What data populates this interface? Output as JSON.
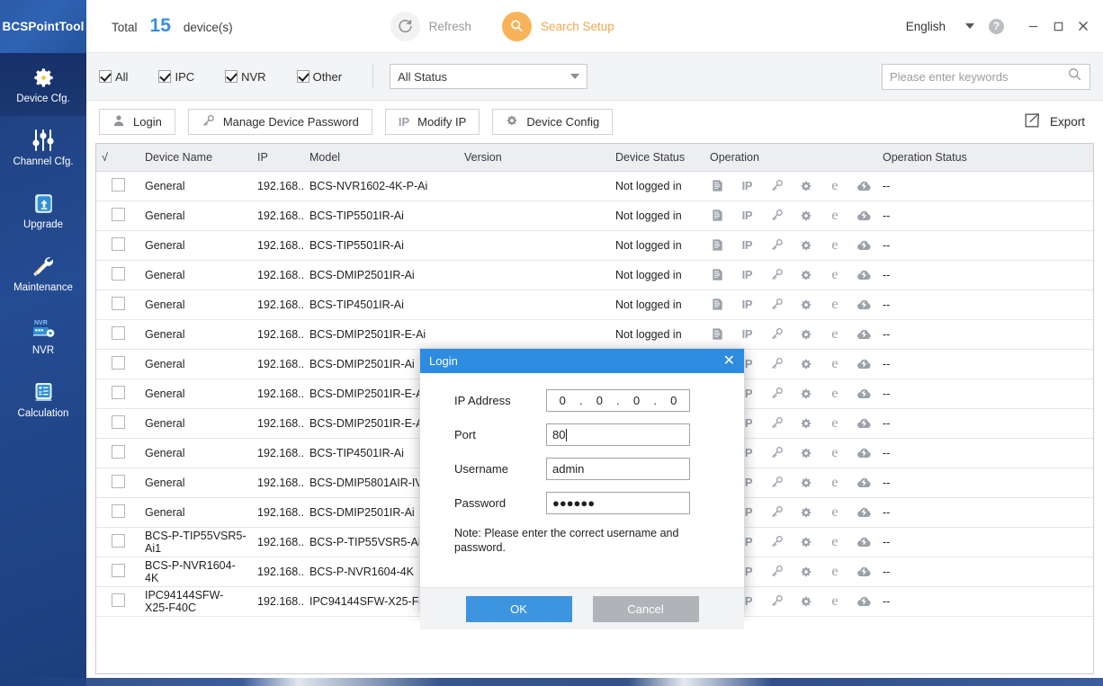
{
  "app": {
    "title": "BCSPointTool",
    "total_label": "Total",
    "total_count": "15",
    "total_unit": "device(s)"
  },
  "topbar": {
    "refresh_label": "Refresh",
    "refresh_icon": "refresh-icon",
    "search_setup_label": "Search Setup",
    "search_setup_icon": "search-setup-icon",
    "language": "English",
    "language_caret_icon": "chevron-down-icon",
    "help_icon": "help-icon",
    "help_glyph": "?",
    "minimize_icon": "minimize-icon",
    "minimize_glyph": "─",
    "maximize_icon": "maximize-icon",
    "maximize_glyph": "☐",
    "close_icon": "close-icon",
    "close_glyph": "✕"
  },
  "sidebar": {
    "items": [
      {
        "label": "Device Cfg.",
        "icon": "gear-icon",
        "active": true
      },
      {
        "label": "Channel Cfg.",
        "icon": "sliders-icon",
        "active": false
      },
      {
        "label": "Upgrade",
        "icon": "upload-box-icon",
        "active": false
      },
      {
        "label": "Maintenance",
        "icon": "tools-icon",
        "active": false
      },
      {
        "label": "NVR",
        "icon": "nvr-icon",
        "active": false
      },
      {
        "label": "Calculation",
        "icon": "calculator-icon",
        "active": false
      }
    ]
  },
  "filterbar": {
    "checkboxes": [
      {
        "label": "All",
        "checked": true
      },
      {
        "label": "IPC",
        "checked": true
      },
      {
        "label": "NVR",
        "checked": true
      },
      {
        "label": "Other",
        "checked": true
      }
    ],
    "status_select": {
      "value": "All Status",
      "caret_icon": "chevron-down-icon"
    },
    "search": {
      "placeholder": "Please enter keywords",
      "value": "",
      "icon": "search-icon"
    }
  },
  "actionbar": {
    "buttons": [
      {
        "label": "Login",
        "icon": "user-icon"
      },
      {
        "label": "Manage Device Password",
        "icon": "key-icon"
      },
      {
        "label": "Modify IP",
        "icon": "ip-icon"
      },
      {
        "label": "Device Config",
        "icon": "gear-icon"
      }
    ],
    "export": {
      "label": "Export",
      "icon": "export-icon"
    }
  },
  "table": {
    "columns": [
      "√",
      "Device Name",
      "IP",
      "Model",
      "Version",
      "Device Status",
      "Operation",
      "Operation Status"
    ],
    "operation_icons": [
      "document-icon",
      "ip-icon",
      "key-icon",
      "gear-icon",
      "browser-e-icon",
      "cloud-icon"
    ],
    "rows": [
      {
        "name": "General",
        "ip": "192.168...",
        "model": "BCS-NVR1602-4K-P-Ai",
        "version": "",
        "status": "Not logged in",
        "op_status": "--"
      },
      {
        "name": "General",
        "ip": "192.168...",
        "model": "BCS-TIP5501IR-Ai",
        "version": "",
        "status": "Not logged in",
        "op_status": "--"
      },
      {
        "name": "General",
        "ip": "192.168...",
        "model": "BCS-TIP5501IR-Ai",
        "version": "",
        "status": "Not logged in",
        "op_status": "--"
      },
      {
        "name": "General",
        "ip": "192.168...",
        "model": "BCS-DMIP2501IR-Ai",
        "version": "",
        "status": "Not logged in",
        "op_status": "--"
      },
      {
        "name": "General",
        "ip": "192.168...",
        "model": "BCS-TIP4501IR-Ai",
        "version": "",
        "status": "Not logged in",
        "op_status": "--"
      },
      {
        "name": "General",
        "ip": "192.168...",
        "model": "BCS-DMIP2501IR-E-Ai",
        "version": "",
        "status": "Not logged in",
        "op_status": "--"
      },
      {
        "name": "General",
        "ip": "192.168...",
        "model": "BCS-DMIP2501IR-Ai",
        "version": "",
        "status": "",
        "op_status": "--"
      },
      {
        "name": "General",
        "ip": "192.168...",
        "model": "BCS-DMIP2501IR-E-Ai",
        "version": "",
        "status": "",
        "op_status": "--"
      },
      {
        "name": "General",
        "ip": "192.168...",
        "model": "BCS-DMIP2501IR-E-Ai",
        "version": "",
        "status": "",
        "op_status": "--"
      },
      {
        "name": "General",
        "ip": "192.168...",
        "model": "BCS-TIP4501IR-Ai",
        "version": "",
        "status": "",
        "op_status": "--"
      },
      {
        "name": "General",
        "ip": "192.168...",
        "model": "BCS-DMIP5801AIR-IV",
        "version": "",
        "status": "",
        "op_status": "--"
      },
      {
        "name": "General",
        "ip": "192.168...",
        "model": "BCS-DMIP2501IR-Ai",
        "version": "",
        "status": "",
        "op_status": "--"
      },
      {
        "name": "BCS-P-TIP55VSR5-Ai1",
        "ip": "192.168...",
        "model": "BCS-P-TIP55VSR5-Ai1",
        "version": "",
        "status": "",
        "op_status": "--"
      },
      {
        "name": "BCS-P-NVR1604-4K",
        "ip": "192.168...",
        "model": "BCS-P-NVR1604-4K",
        "version": "",
        "status": "",
        "op_status": "--"
      },
      {
        "name": "IPC94144SFW-X25-F40C",
        "ip": "192.168...",
        "model": "IPC94144SFW-X25-F40C",
        "version": "",
        "status": "",
        "op_status": "--"
      }
    ]
  },
  "login_dialog": {
    "title": "Login",
    "close_icon": "close-icon",
    "close_glyph": "✕",
    "fields": {
      "ip_label": "IP Address",
      "ip_octets": [
        "0",
        "0",
        "0",
        "0"
      ],
      "ip_separator": ".",
      "port_label": "Port",
      "port_value": "80",
      "username_label": "Username",
      "username_value": "admin",
      "password_label": "Password",
      "password_value": "●●●●●●"
    },
    "note": "Note: Please enter the correct username and password.",
    "ok_label": "OK",
    "cancel_label": "Cancel"
  },
  "colors": {
    "brand_blue": "#1e3f7e",
    "accent_blue": "#3d95e0",
    "count_blue": "#3b8ede",
    "orange": "#f7b35a",
    "header_grey": "#eceef1"
  }
}
